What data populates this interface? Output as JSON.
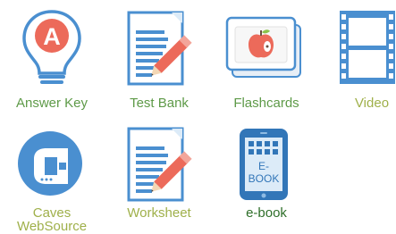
{
  "colors": {
    "blue": "#4a8fd0",
    "blue_dark": "#3276b8",
    "red": "#ec6a5a",
    "green_label": "#5e9a48",
    "olive_label": "#9fb04a",
    "dark_label": "#2f6f2a"
  },
  "resources": [
    {
      "id": "answer-key",
      "label": "Answer Key",
      "icon": "lightbulb-a-icon"
    },
    {
      "id": "test-bank",
      "label": "Test Bank",
      "icon": "document-pencil-icon"
    },
    {
      "id": "flashcards",
      "label": "Flashcards",
      "icon": "flashcard-apple-icon"
    },
    {
      "id": "video",
      "label": "Video",
      "icon": "film-strip-icon"
    },
    {
      "id": "caves-websource",
      "label": "Caves WebSource",
      "label_lines": [
        "Caves",
        "WebSource"
      ],
      "icon": "caves-c-tablet-icon"
    },
    {
      "id": "worksheet",
      "label": "Worksheet",
      "icon": "document-pencil-icon"
    },
    {
      "id": "e-book",
      "label": "e-book",
      "icon": "ebook-tablet-icon",
      "icon_text": [
        "E-",
        "BOOK"
      ]
    }
  ]
}
